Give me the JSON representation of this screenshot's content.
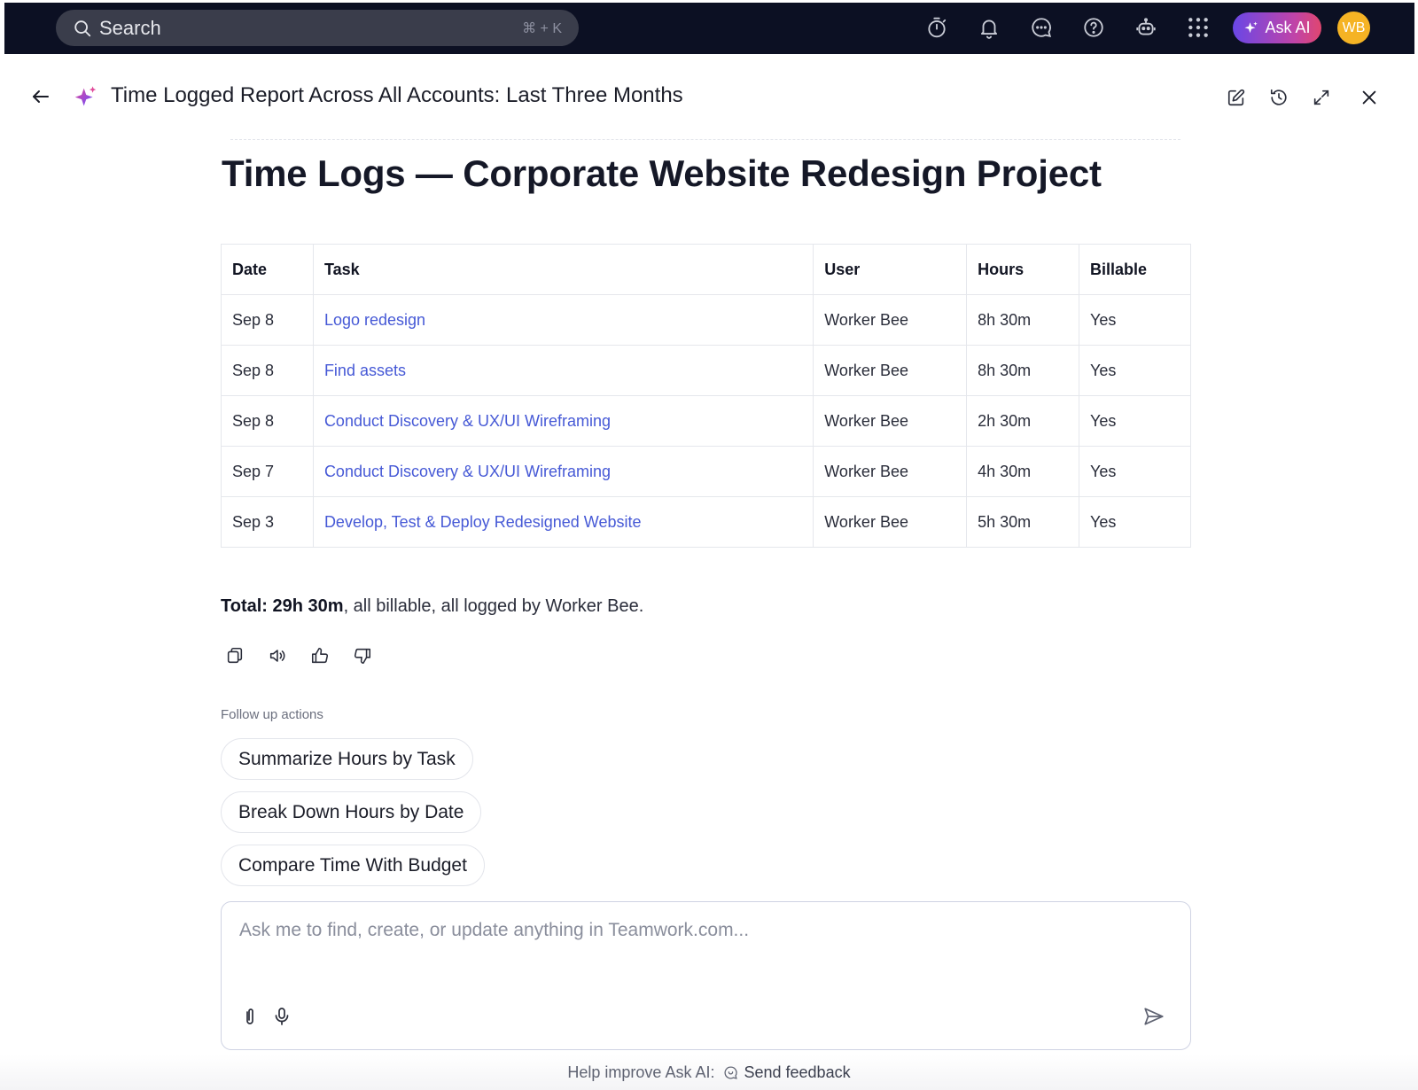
{
  "topbar": {
    "search_label": "Search",
    "search_shortcut": "⌘ + K",
    "ask_ai_label": "Ask AI",
    "avatar_initials": "WB",
    "colors": {
      "bar": "#0c1023",
      "avatar": "#f5b324",
      "link": "#4659d6"
    }
  },
  "header": {
    "title": "Time Logged Report Across All Accounts: Last Three Months"
  },
  "content": {
    "heading": "Time Logs — Corporate Website Redesign Project",
    "table": {
      "columns": [
        "Date",
        "Task",
        "User",
        "Hours",
        "Billable"
      ],
      "rows": [
        [
          "Sep 8",
          "Logo redesign",
          "Worker Bee",
          "8h 30m",
          "Yes"
        ],
        [
          "Sep 8",
          "Find assets",
          "Worker Bee",
          "8h 30m",
          "Yes"
        ],
        [
          "Sep 8",
          "Conduct Discovery & UX/UI Wireframing",
          "Worker Bee",
          "2h 30m",
          "Yes"
        ],
        [
          "Sep 7",
          "Conduct Discovery & UX/UI Wireframing",
          "Worker Bee",
          "4h 30m",
          "Yes"
        ],
        [
          "Sep 3",
          "Develop, Test & Deploy Redesigned Website",
          "Worker Bee",
          "5h 30m",
          "Yes"
        ]
      ]
    },
    "total_label": "Total: 29h 30m",
    "total_rest": ", all billable, all logged by Worker Bee.",
    "follow_up_label": "Follow up actions",
    "follow_up_actions": [
      "Summarize Hours by Task",
      "Break Down Hours by Date",
      "Compare Time With Budget"
    ]
  },
  "composer": {
    "placeholder": "Ask me to find, create, or update anything in Teamwork.com..."
  },
  "footer": {
    "prompt": "Help improve Ask AI:",
    "link": "Send feedback"
  }
}
